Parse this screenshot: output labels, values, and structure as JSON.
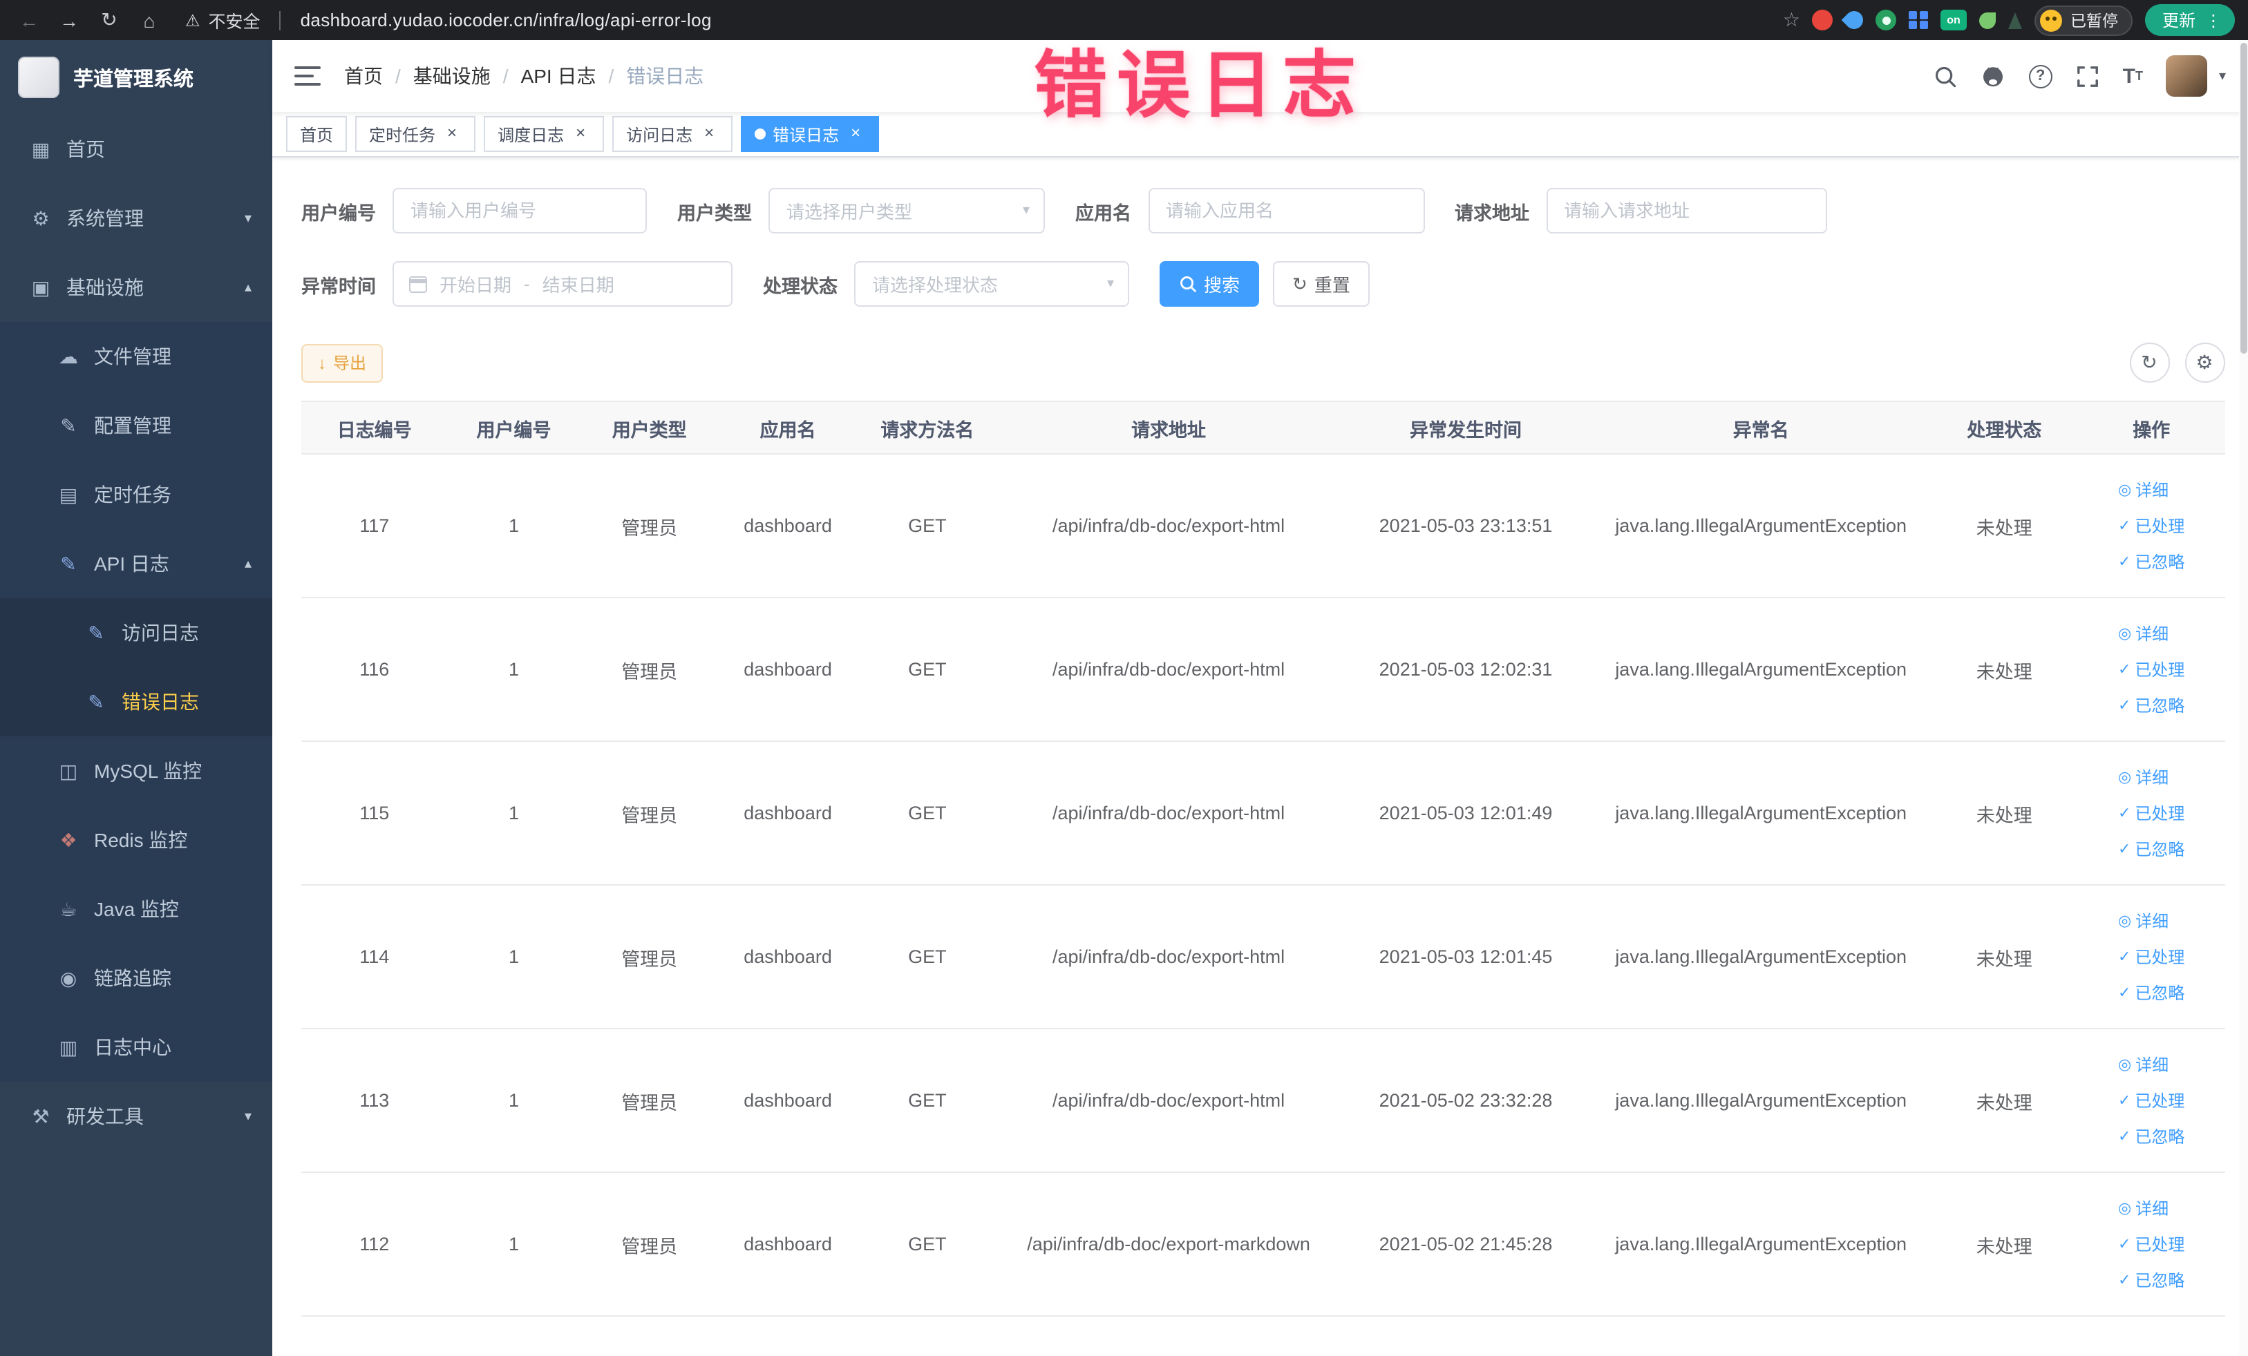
{
  "browser": {
    "back_icon": "←",
    "forward_icon": "→",
    "refresh_icon": "↻",
    "home_icon": "⌂",
    "warning_icon": "⚠",
    "security_label": "不安全",
    "url": "dashboard.yudao.iocoder.cn/infra/log/api-error-log",
    "star_icon": "☆",
    "extension_on_text": "on",
    "paused_badge": "已暂停",
    "update_button": "更新",
    "menu_icon": "⋮"
  },
  "annotation": {
    "text": "错误日志"
  },
  "sidebar": {
    "app_title": "芋道管理系统",
    "items": [
      {
        "icon": "▦",
        "label": "首页"
      },
      {
        "icon": "⚙",
        "label": "系统管理",
        "chevron": "▾"
      },
      {
        "icon": "▣",
        "label": "基础设施",
        "chevron": "▴"
      },
      {
        "icon": "☁",
        "label": "文件管理"
      },
      {
        "icon": "✎",
        "label": "配置管理"
      },
      {
        "icon": "▤",
        "label": "定时任务"
      },
      {
        "icon": "✎",
        "label": "API 日志",
        "chevron": "▴"
      },
      {
        "icon": "✎",
        "label": "访问日志"
      },
      {
        "icon": "✎",
        "label": "错误日志"
      },
      {
        "icon": "◫",
        "label": "MySQL 监控"
      },
      {
        "icon": "❖",
        "label": "Redis 监控"
      },
      {
        "icon": "☕",
        "label": "Java 监控"
      },
      {
        "icon": "◉",
        "label": "链路追踪"
      },
      {
        "icon": "▥",
        "label": "日志中心"
      },
      {
        "icon": "⚒",
        "label": "研发工具",
        "chevron": "▾"
      }
    ]
  },
  "breadcrumb": {
    "items": [
      "首页",
      "基础设施",
      "API 日志",
      "错误日志"
    ],
    "separator": "/"
  },
  "tabs": [
    {
      "label": "首页"
    },
    {
      "label": "定时任务",
      "close": "×"
    },
    {
      "label": "调度日志",
      "close": "×"
    },
    {
      "label": "访问日志",
      "close": "×"
    },
    {
      "label": "错误日志",
      "close": "×"
    }
  ],
  "filters": {
    "user_id": {
      "label": "用户编号",
      "placeholder": "请输入用户编号"
    },
    "user_type": {
      "label": "用户类型",
      "placeholder": "请选择用户类型"
    },
    "app_name": {
      "label": "应用名",
      "placeholder": "请输入应用名"
    },
    "request_url": {
      "label": "请求地址",
      "placeholder": "请输入请求地址"
    },
    "exception_time": {
      "label": "异常时间",
      "start_placeholder": "开始日期",
      "separator": "-",
      "end_placeholder": "结束日期"
    },
    "process_status": {
      "label": "处理状态",
      "placeholder": "请选择处理状态"
    },
    "search_button": "搜索",
    "reset_button": "重置"
  },
  "toolbar": {
    "export_button": "导出",
    "refresh_icon": "↻",
    "settings_icon": "⚙",
    "download_icon": "↓"
  },
  "table": {
    "columns": [
      "日志编号",
      "用户编号",
      "用户类型",
      "应用名",
      "请求方法名",
      "请求地址",
      "异常发生时间",
      "异常名",
      "处理状态",
      "操作"
    ],
    "actions": {
      "detail": {
        "icon": "◎",
        "label": "详细"
      },
      "process": {
        "icon": "✓",
        "label": "已处理"
      },
      "ignore": {
        "icon": "✓",
        "label": "已忽略"
      }
    },
    "rows": [
      {
        "id": "117",
        "user_id": "1",
        "user_type": "管理员",
        "app_name": "dashboard",
        "method": "GET",
        "url": "/api/infra/db-doc/export-html",
        "time": "2021-05-03 23:13:51",
        "exception": "java.lang.IllegalArgumentException",
        "status": "未处理"
      },
      {
        "id": "116",
        "user_id": "1",
        "user_type": "管理员",
        "app_name": "dashboard",
        "method": "GET",
        "url": "/api/infra/db-doc/export-html",
        "time": "2021-05-03 12:02:31",
        "exception": "java.lang.IllegalArgumentException",
        "status": "未处理"
      },
      {
        "id": "115",
        "user_id": "1",
        "user_type": "管理员",
        "app_name": "dashboard",
        "method": "GET",
        "url": "/api/infra/db-doc/export-html",
        "time": "2021-05-03 12:01:49",
        "exception": "java.lang.IllegalArgumentException",
        "status": "未处理"
      },
      {
        "id": "114",
        "user_id": "1",
        "user_type": "管理员",
        "app_name": "dashboard",
        "method": "GET",
        "url": "/api/infra/db-doc/export-html",
        "time": "2021-05-03 12:01:45",
        "exception": "java.lang.IllegalArgumentException",
        "status": "未处理"
      },
      {
        "id": "113",
        "user_id": "1",
        "user_type": "管理员",
        "app_name": "dashboard",
        "method": "GET",
        "url": "/api/infra/db-doc/export-html",
        "time": "2021-05-02 23:32:28",
        "exception": "java.lang.IllegalArgumentException",
        "status": "未处理"
      },
      {
        "id": "112",
        "user_id": "1",
        "user_type": "管理员",
        "app_name": "dashboard",
        "method": "GET",
        "url": "/api/infra/db-doc/export-markdown",
        "time": "2021-05-02 21:45:28",
        "exception": "java.lang.IllegalArgumentException",
        "status": "未处理"
      }
    ]
  },
  "colors": {
    "accent": "#409eff",
    "active_tab": "#409eff",
    "sidebar_bg": "#304156",
    "active_menu_text": "#ffd04b",
    "warning_button": "#e6a23c",
    "annotation": "#f8436a",
    "chrome_bg": "#202124",
    "update_pill": "#1ba784"
  }
}
